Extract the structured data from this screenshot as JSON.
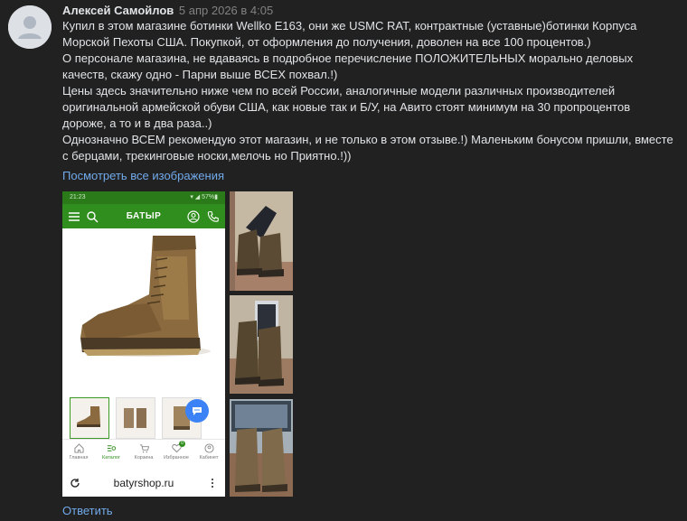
{
  "post": {
    "author": "Алексей Самойлов",
    "date": "5 апр 2026 в 4:05",
    "paragraphs": [
      "Купил в этом магазине ботинки Wellko E163, они же USMC RAT, контрактные (уставные)ботинки Корпуса Морской Пехоты США. Покупкой, от оформления до получения, доволен на все 100 процентов.)",
      "О персонале магазина, не вдаваясь в подробное перечисление ПОЛОЖИТЕЛЬНЫХ морально деловых качеств, скажу одно - Парни выше ВСЕХ похвал.!)",
      "Цены здесь значительно ниже чем по всей России, аналогичные модели различных производителей оригинальной армейской обуви США, как новые так и Б/У, на Авито стоят минимум на 30 пропроцентов дороже, а то и в два раза..)",
      "Однозначно ВСЕМ рекомендую этот магазин, и не только в этом отзыве.!) Маленьким бонусом пришли, вместе с берцами, трекинговые носки,мелочь но Приятно.!))"
    ],
    "see_all_label": "Посмотреть все изображения",
    "reply_label": "Ответить"
  },
  "phone": {
    "status_time": "21:23",
    "status_right": "▾ ◢ 57%▮",
    "brand": "БАТЫР",
    "nav": [
      {
        "label": "Главная",
        "icon": "home-icon"
      },
      {
        "label": "Каталог",
        "icon": "catalog-icon"
      },
      {
        "label": "Корзина",
        "icon": "cart-icon"
      },
      {
        "label": "Избранное",
        "icon": "heart-icon"
      },
      {
        "label": "Кабинет",
        "icon": "user-icon"
      }
    ],
    "favorites_badge": "0",
    "url": "batyrshop.ru"
  },
  "colors": {
    "background": "#212121",
    "link": "#71aaeb",
    "date": "#828282",
    "brand_green": "#2f8e1d"
  }
}
